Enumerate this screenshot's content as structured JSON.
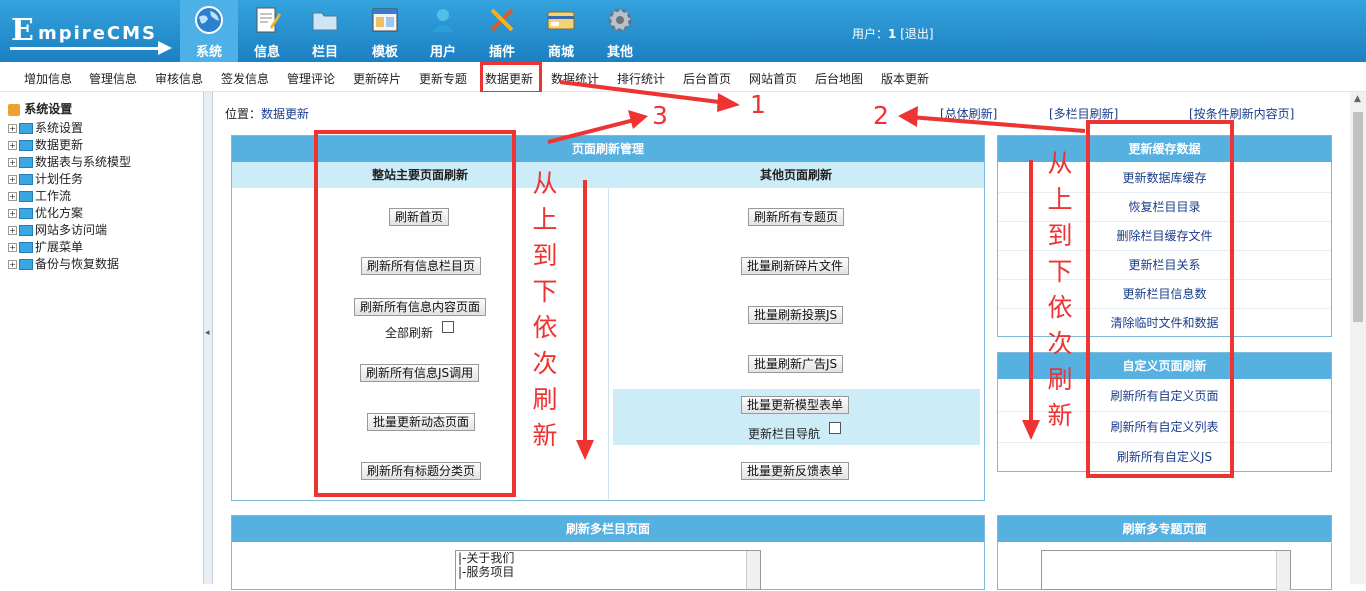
{
  "app": {
    "logo_first": "E",
    "logo_rest": "mpireCMS"
  },
  "topnav": [
    {
      "label": "系统",
      "icon": "globe-icon"
    },
    {
      "label": "信息",
      "icon": "document-edit-icon"
    },
    {
      "label": "栏目",
      "icon": "folder-icon"
    },
    {
      "label": "模板",
      "icon": "template-window-icon"
    },
    {
      "label": "用户",
      "icon": "user-icon"
    },
    {
      "label": "插件",
      "icon": "tools-icon"
    },
    {
      "label": "商城",
      "icon": "card-icon"
    },
    {
      "label": "其他",
      "icon": "gear-icon"
    }
  ],
  "user": {
    "prefix": "用户：",
    "name": "1",
    "logout": "[退出]"
  },
  "menu": [
    "增加信息",
    "管理信息",
    "审核信息",
    "签发信息",
    "管理评论",
    "更新碎片",
    "更新专题",
    "数据更新",
    "数据统计",
    "排行统计",
    "后台首页",
    "网站首页",
    "后台地图",
    "版本更新"
  ],
  "sidebar": {
    "root": "系统设置",
    "items": [
      "系统设置",
      "数据更新",
      "数据表与系统模型",
      "计划任务",
      "工作流",
      "优化方案",
      "网站多访问端",
      "扩展菜单",
      "备份与恢复数据"
    ]
  },
  "location": {
    "label": "位置：",
    "value": "数据更新"
  },
  "toplinks": [
    "[总体刷新]",
    "[多栏目刷新]",
    "[按条件刷新内容页]"
  ],
  "refresh_panel": {
    "title": "页面刷新管理",
    "left_header": "整站主要页面刷新",
    "right_header": "其他页面刷新",
    "left_buttons": [
      "刷新首页",
      "刷新所有信息栏目页",
      "刷新所有信息内容页面",
      "刷新所有信息JS调用",
      "批量更新动态页面",
      "刷新所有标题分类页"
    ],
    "all_refresh_label": "全部刷新",
    "right_buttons": [
      "刷新所有专题页",
      "批量刷新碎片文件",
      "批量刷新投票JS",
      "批量刷新广告JS",
      "批量更新模型表单",
      "批量更新反馈表单"
    ],
    "nav_update_label": "更新栏目导航"
  },
  "cache_panel": {
    "title": "更新缓存数据",
    "links": [
      "更新数据库缓存",
      "恢复栏目目录",
      "删除栏目缓存文件",
      "更新栏目关系",
      "更新栏目信息数",
      "清除临时文件和数据"
    ]
  },
  "custom_panel": {
    "title": "自定义页面刷新",
    "links": [
      "刷新所有自定义页面",
      "刷新所有自定义列表",
      "刷新所有自定义JS"
    ]
  },
  "multi_column_panel": {
    "title": "刷新多栏目页面",
    "list": [
      "|-关于我们",
      "|-服务项目"
    ]
  },
  "multi_topic_panel": {
    "title": "刷新多专题页面"
  },
  "annotations": {
    "n1": "1",
    "n2": "2",
    "n3": "3",
    "vertical_left": [
      "从",
      "上",
      "到",
      "下",
      "依",
      "次",
      "刷",
      "新"
    ],
    "vertical_right": [
      "从",
      "上",
      "到",
      "下",
      "依",
      "次",
      "刷",
      "新"
    ]
  },
  "colors": {
    "header_blue": "#1c80c2",
    "panel_head": "#56b0e0",
    "annotation_red": "#e33"
  }
}
